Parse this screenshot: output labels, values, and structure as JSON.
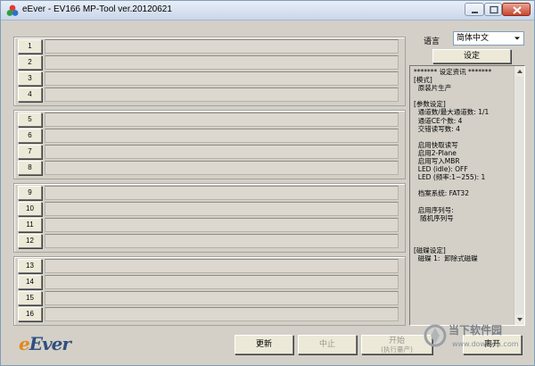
{
  "window": {
    "title": "eEver - EV166 MP-Tool ver.20120621"
  },
  "ports": {
    "group1": [
      "1",
      "2",
      "3",
      "4"
    ],
    "group2": [
      "5",
      "6",
      "7",
      "8"
    ],
    "group3": [
      "9",
      "10",
      "11",
      "12"
    ],
    "group4": [
      "13",
      "14",
      "15",
      "16"
    ]
  },
  "settings": {
    "language_label": "语言",
    "language_value": "简体中文",
    "settings_button": "设定"
  },
  "info": {
    "lines": [
      "******* 设定资讯 *******",
      "[模式]",
      "  原装片生产",
      "",
      "[参数设定]",
      "  通道数/最大通道数: 1/1",
      "  通道CE个数: 4",
      "  交错读写数: 4",
      "",
      "  启用快取读写",
      "  启用2-Plane",
      "  启用写入MBR",
      "  LED (idle): OFF",
      "  LED (频率:1~255): 1",
      "",
      "  档案系统: FAT32",
      "",
      "  启用序列号:",
      "   随机序列号",
      "",
      "",
      "",
      "[磁碟设定]",
      "  磁碟 1:  卸除式磁碟"
    ]
  },
  "logo": {
    "prefix": "e",
    "rest": "Ever"
  },
  "actions": {
    "refresh": "更新",
    "stop": "中止",
    "start_line1": "开始",
    "start_line2": "(执行量产)",
    "exit": "离开"
  },
  "watermark": {
    "line1": "当下软件园",
    "line2": "www.downxia.com"
  }
}
